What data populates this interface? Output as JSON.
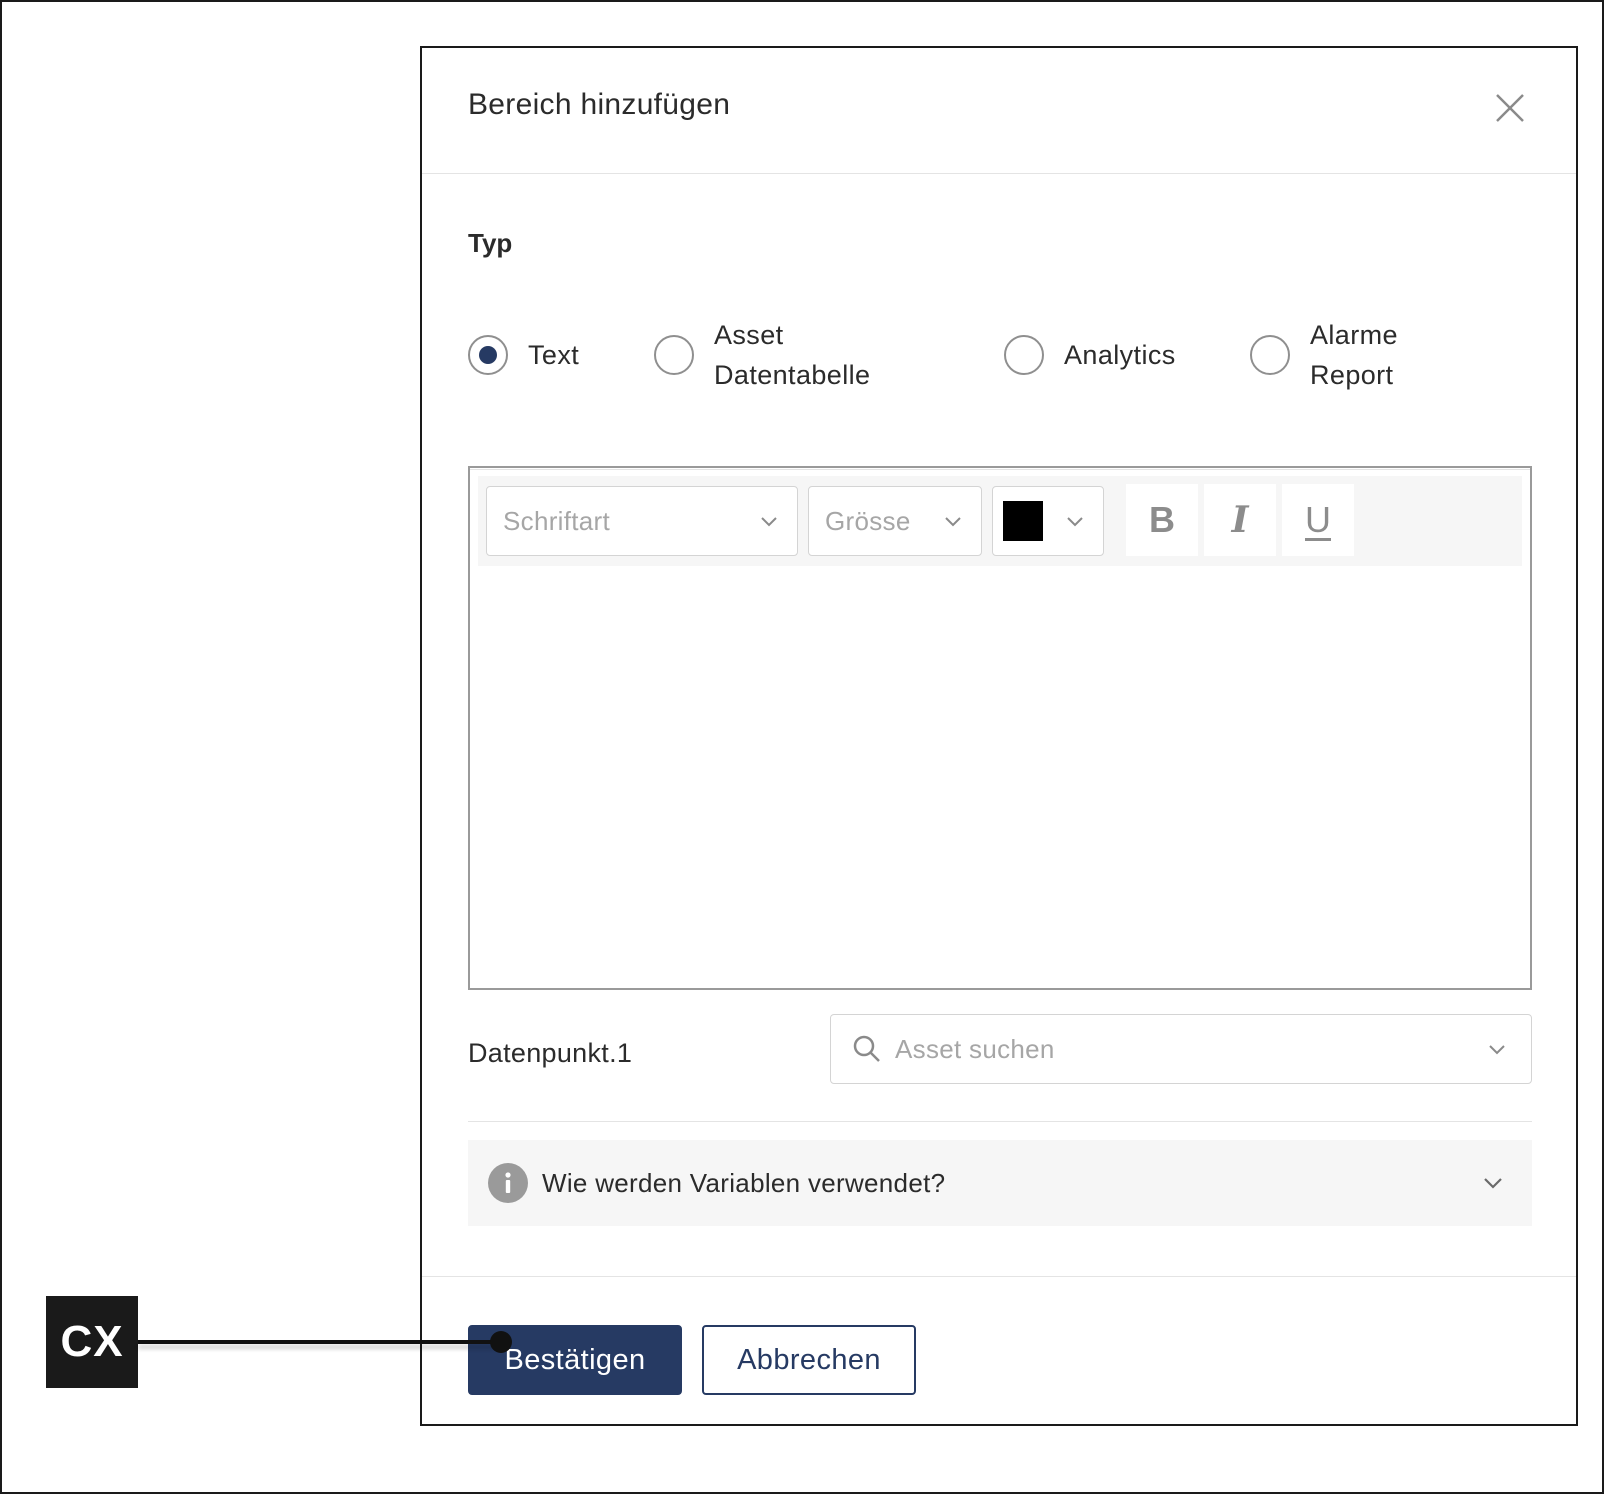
{
  "dialog": {
    "title": "Bereich hinzufügen",
    "close_icon": "close-icon"
  },
  "type_section": {
    "label": "Typ",
    "options": [
      {
        "label": "Text",
        "checked": true
      },
      {
        "label_line1": "Asset",
        "label_line2": "Datentabelle",
        "checked": false
      },
      {
        "label": "Analytics",
        "checked": false
      },
      {
        "label_line1": "Alarme",
        "label_line2": "Report",
        "checked": false
      }
    ]
  },
  "toolbar": {
    "font_placeholder": "Schriftart",
    "size_placeholder": "Grösse",
    "color_value": "#000000",
    "bold_label": "B",
    "italic_label": "I",
    "underline_label": "U"
  },
  "datapoint": {
    "label": "Datenpunkt.1",
    "search_placeholder": "Asset suchen"
  },
  "info": {
    "text": "Wie werden Variablen verwendet?"
  },
  "footer": {
    "confirm_label": "Bestätigen",
    "cancel_label": "Abbrechen"
  },
  "callout": {
    "label": "CX"
  },
  "colors": {
    "primary": "#263a63",
    "border": "#d4d4d4",
    "placeholder": "#a6a6a6",
    "panel_bg": "#f6f6f6"
  }
}
